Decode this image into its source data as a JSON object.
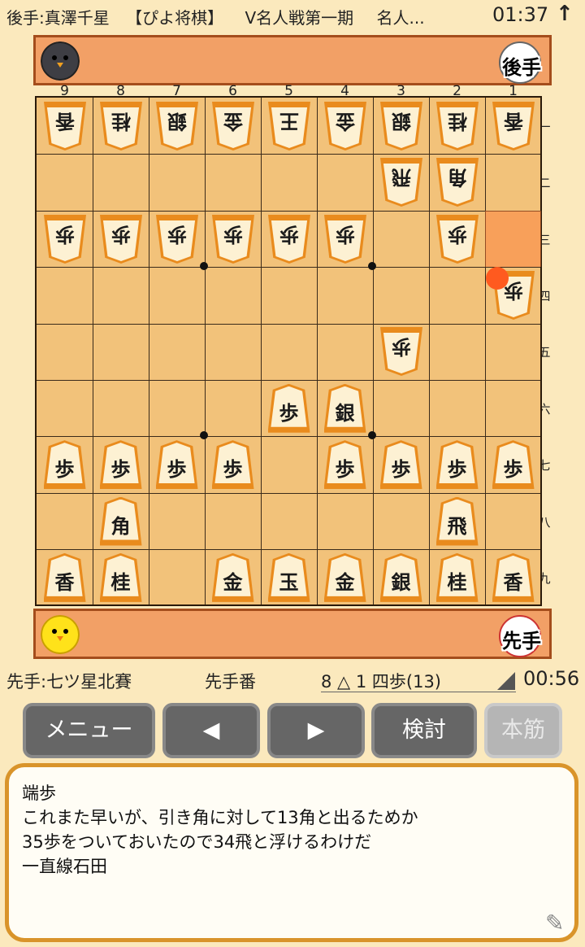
{
  "header": {
    "gote_player_label": "後手:真澤千星",
    "app_name": "【ぴよ将棋】",
    "event": "V名人戦第一期",
    "title_truncated": "名人...",
    "gote_clock": "01:37",
    "arrow": "↑"
  },
  "gote_bar": {
    "badge_text": "後手"
  },
  "sente_bar": {
    "badge_text": "先手"
  },
  "board": {
    "file_labels": [
      "9",
      "8",
      "7",
      "6",
      "5",
      "4",
      "3",
      "2",
      "1"
    ],
    "rank_labels": [
      "一",
      "二",
      "三",
      "四",
      "五",
      "六",
      "七",
      "八",
      "九"
    ],
    "highlight_square": "1三",
    "pieces": [
      {
        "sq": "9一",
        "ch": "香",
        "owner": "gote"
      },
      {
        "sq": "8一",
        "ch": "桂",
        "owner": "gote"
      },
      {
        "sq": "7一",
        "ch": "銀",
        "owner": "gote"
      },
      {
        "sq": "6一",
        "ch": "金",
        "owner": "gote"
      },
      {
        "sq": "5一",
        "ch": "王",
        "owner": "gote"
      },
      {
        "sq": "4一",
        "ch": "金",
        "owner": "gote"
      },
      {
        "sq": "3一",
        "ch": "銀",
        "owner": "gote"
      },
      {
        "sq": "2一",
        "ch": "桂",
        "owner": "gote"
      },
      {
        "sq": "1一",
        "ch": "香",
        "owner": "gote"
      },
      {
        "sq": "3二",
        "ch": "飛",
        "owner": "gote"
      },
      {
        "sq": "2二",
        "ch": "角",
        "owner": "gote"
      },
      {
        "sq": "9三",
        "ch": "歩",
        "owner": "gote"
      },
      {
        "sq": "8三",
        "ch": "歩",
        "owner": "gote"
      },
      {
        "sq": "7三",
        "ch": "歩",
        "owner": "gote"
      },
      {
        "sq": "6三",
        "ch": "歩",
        "owner": "gote"
      },
      {
        "sq": "5三",
        "ch": "歩",
        "owner": "gote"
      },
      {
        "sq": "4三",
        "ch": "歩",
        "owner": "gote"
      },
      {
        "sq": "2三",
        "ch": "歩",
        "owner": "gote"
      },
      {
        "sq": "1四",
        "ch": "歩",
        "owner": "gote"
      },
      {
        "sq": "3五",
        "ch": "歩",
        "owner": "gote"
      },
      {
        "sq": "5六",
        "ch": "歩",
        "owner": "sente"
      },
      {
        "sq": "4六",
        "ch": "銀",
        "owner": "sente"
      },
      {
        "sq": "9七",
        "ch": "歩",
        "owner": "sente"
      },
      {
        "sq": "8七",
        "ch": "歩",
        "owner": "sente"
      },
      {
        "sq": "7七",
        "ch": "歩",
        "owner": "sente"
      },
      {
        "sq": "6七",
        "ch": "歩",
        "owner": "sente"
      },
      {
        "sq": "4七",
        "ch": "歩",
        "owner": "sente"
      },
      {
        "sq": "3七",
        "ch": "歩",
        "owner": "sente"
      },
      {
        "sq": "2七",
        "ch": "歩",
        "owner": "sente"
      },
      {
        "sq": "1七",
        "ch": "歩",
        "owner": "sente"
      },
      {
        "sq": "8八",
        "ch": "角",
        "owner": "sente"
      },
      {
        "sq": "2八",
        "ch": "飛",
        "owner": "sente"
      },
      {
        "sq": "9九",
        "ch": "香",
        "owner": "sente"
      },
      {
        "sq": "8九",
        "ch": "桂",
        "owner": "sente"
      },
      {
        "sq": "6九",
        "ch": "金",
        "owner": "sente"
      },
      {
        "sq": "5九",
        "ch": "玉",
        "owner": "sente"
      },
      {
        "sq": "4九",
        "ch": "金",
        "owner": "sente"
      },
      {
        "sq": "3九",
        "ch": "銀",
        "owner": "sente"
      },
      {
        "sq": "2九",
        "ch": "桂",
        "owner": "sente"
      },
      {
        "sq": "1九",
        "ch": "香",
        "owner": "sente"
      }
    ]
  },
  "status": {
    "sente_player_label": "先手:七ツ星北賽",
    "turn": "先手番",
    "last_move": "8 △ 1 四歩(13)",
    "sente_clock": "00:56"
  },
  "buttons": {
    "menu": "メニュー",
    "prev": "◀",
    "next": "▶",
    "analyze": "検討",
    "mainline": "本筋"
  },
  "comment": {
    "lines": [
      "端歩",
      "これまた早いが、引き角に対して13角と出るためか",
      "35歩をついておいたので34飛と浮けるわけだ",
      "一直線石田"
    ]
  },
  "colors": {
    "background": "#fbe9bd",
    "hand_bar": "#f2a066",
    "board": "#f2c27a",
    "accent": "#d9942a"
  }
}
